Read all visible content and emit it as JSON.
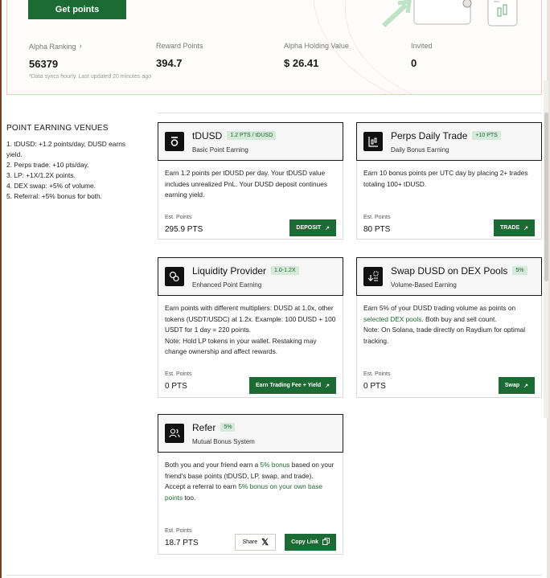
{
  "header": {
    "get_points_label": "Get points"
  },
  "stats": [
    {
      "label": "Alpha Ranking",
      "value": "56379",
      "has_chevron": true
    },
    {
      "label": "Reward Points",
      "value": "394.7",
      "has_chevron": false
    },
    {
      "label": "Alpha Holding Value",
      "value": "$ 26.41",
      "has_chevron": false
    },
    {
      "label": "Invited",
      "value": "0",
      "has_chevron": false
    }
  ],
  "sync_note": "*Data syncs hourly. Last updated 20 minutes ago",
  "venues": {
    "title": "POINT EARNING VENUES",
    "items": [
      "1. tDUSD: +1.2 points/day, DUSD earns yield.",
      "2. Perps trade: +10 pts/day.",
      "3. LP: +1X/1.2X points.",
      "4. DEX swap: +5% of volume.",
      "5. Referral: +5% bonus for both."
    ]
  },
  "cards": {
    "tdusd": {
      "title": "tDUSD",
      "badge": "1.2 PTS / tDUSD",
      "subtitle": "Basic Point Earning",
      "desc": "Earn 1.2 points per tDUSD per day. Your tDUSD value includes unrealized PnL. Your DUSD deposit continues earning yield.",
      "est_label": "Est. Points",
      "est_value": "295.9 PTS",
      "button": "DEPOSIT",
      "icon": "tdusd-token-icon"
    },
    "perps": {
      "title": "Perps Daily Trade",
      "badge": "+10 PTS",
      "subtitle": "Daily Bonus Earning",
      "desc": "Earn 10 bonus points per UTC day by placing 2+ trades totaling 100+ tDUSD.",
      "est_label": "Est. Points",
      "est_value": "80 PTS",
      "button": "TRADE",
      "icon": "chart-candle-icon"
    },
    "lp": {
      "title": "Liquidity Provider",
      "badge": "1.0-1.2X",
      "subtitle": "Enhanced Point Earning",
      "desc": "Earn points with different multipliers: DUSD at 1.0x, other tokens (USDT/USDC) at 1.2x. Example: 100 DUSD + 100 USDT for 1 day = 220 points.",
      "note": "Note: Hold LP tokens in your wallet. Restaking may change ownership and affect rewards.",
      "est_label": "Est. Points",
      "est_value": "0 PTS",
      "button": "Earn Trading Fee + Yield",
      "icon": "coins-icon"
    },
    "swap": {
      "title": "Swap DUSD on DEX Pools",
      "badge": "5%",
      "subtitle": "Volume-Based Earning",
      "desc_a": "Earn 5% of your DUSD trading volume as points on ",
      "desc_link": "selected DEX pools",
      "desc_b": ". Both buy and sell count.",
      "note": "Note: On Solana, trade directly on Raydium for optimal tracking.",
      "est_label": "Est. Points",
      "est_value": "0 PTS",
      "button": "Swap",
      "icon": "swap-icon"
    },
    "refer": {
      "title": "Refer",
      "badge": "5%",
      "subtitle": "Mutual Bonus System",
      "desc_a": "Both you and your friend earn a ",
      "desc_hl": "5% bonus",
      "desc_b": " based on your friend's base points (tDUSD, LP, swap, and trade).",
      "desc_c": "Accept a referral to earn ",
      "desc_hl2": "5% bonus on your own base points",
      "desc_d": " too.",
      "est_label": "Est. Points",
      "est_value": "18.7 PTS",
      "share_button": "Share",
      "copy_button": "Copy Link",
      "icon": "users-icon"
    }
  },
  "colors": {
    "accent": "#1d6b34",
    "badge_bg": "#d6ead9",
    "panel_border": "#f2c9b8"
  }
}
